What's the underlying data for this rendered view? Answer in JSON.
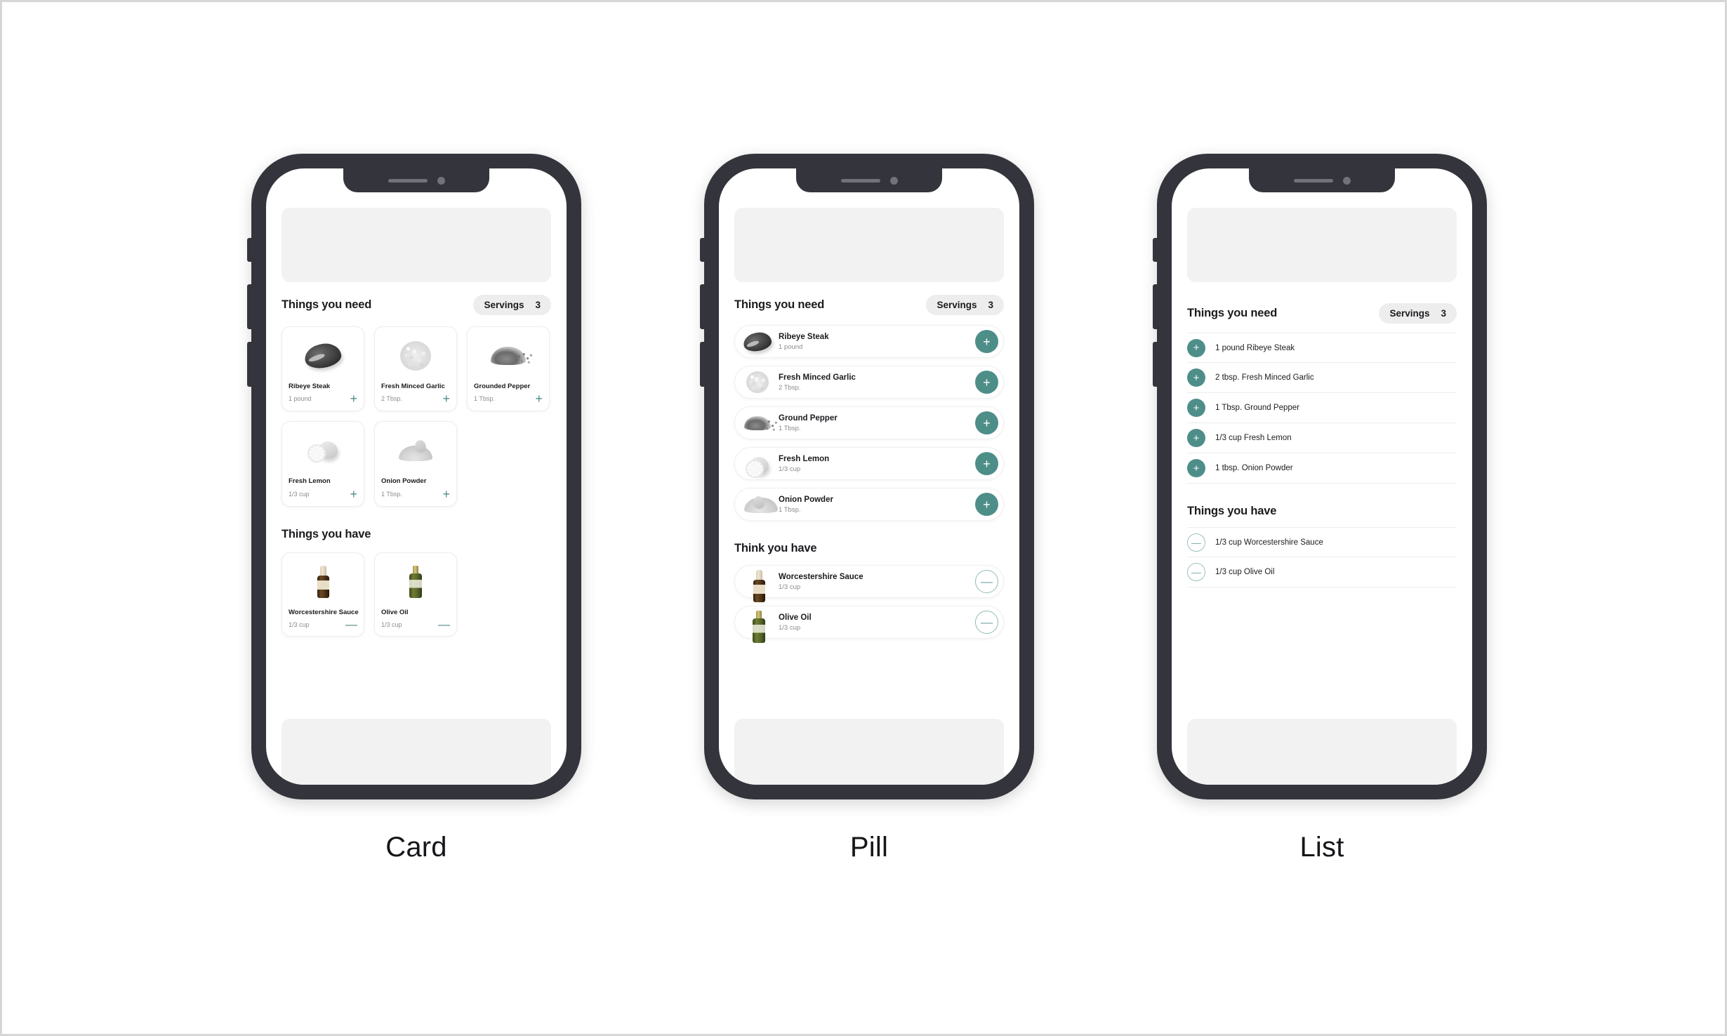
{
  "theme": {
    "accent_teal": "#4e8e89",
    "accent_teal_outline": "#8ebab6",
    "frame_dark": "#34343c",
    "placeholder_gray": "#f2f2f2",
    "pill_gray": "#ededed",
    "text_primary": "#1b1b1f",
    "text_muted": "#8b8b90"
  },
  "variants": [
    {
      "caption": "Card",
      "sections": [
        {
          "title": "Things you need",
          "servings": {
            "label": "Servings",
            "value": "3"
          },
          "items": [
            {
              "name": "Ribeye Steak",
              "qty": "1 pound",
              "action": "+",
              "icon": "steak-image"
            },
            {
              "name": "Fresh Minced Garlic",
              "qty": "2 Tbsp.",
              "action": "+",
              "icon": "garlic-image"
            },
            {
              "name": "Grounded Pepper",
              "qty": "1 Tbsp.",
              "action": "+",
              "icon": "ground-pepper-image"
            },
            {
              "name": "Fresh Lemon",
              "qty": "1/3 cup",
              "action": "+",
              "icon": "lemon-image"
            },
            {
              "name": "Onion Powder",
              "qty": "1 Tbsp.",
              "action": "+",
              "icon": "onion-powder-image"
            }
          ]
        },
        {
          "title": "Things you have",
          "items": [
            {
              "name": "Worcestershire Sauce",
              "qty": "1/3 cup",
              "action": "—",
              "icon": "worcestershire-sauce-image"
            },
            {
              "name": "Olive Oil",
              "qty": "1/3 cup",
              "action": "—",
              "icon": "olive-oil-image"
            }
          ]
        }
      ]
    },
    {
      "caption": "Pill",
      "sections": [
        {
          "title": "Things you need",
          "servings": {
            "label": "Servings",
            "value": "3"
          },
          "items": [
            {
              "name": "Ribeye Steak",
              "qty": "1 pound",
              "action": "+",
              "icon": "steak-image"
            },
            {
              "name": "Fresh Minced Garlic",
              "qty": "2 Tbsp.",
              "action": "+",
              "icon": "garlic-image"
            },
            {
              "name": "Ground Pepper",
              "qty": "1 Tbsp.",
              "action": "+",
              "icon": "ground-pepper-image"
            },
            {
              "name": "Fresh Lemon",
              "qty": "1/3 cup",
              "action": "+",
              "icon": "lemon-image"
            },
            {
              "name": "Onion Powder",
              "qty": "1 Tbsp.",
              "action": "+",
              "icon": "onion-powder-image"
            }
          ]
        },
        {
          "title": "Think you have",
          "items": [
            {
              "name": "Worcestershire Sauce",
              "qty": "1/3 cup",
              "action": "—",
              "icon": "worcestershire-sauce-image"
            },
            {
              "name": "Olive Oil",
              "qty": "1/3 cup",
              "action": "—",
              "icon": "olive-oil-image"
            }
          ]
        }
      ]
    },
    {
      "caption": "List",
      "sections": [
        {
          "title": "Things you need",
          "servings": {
            "label": "Servings",
            "value": "3"
          },
          "items": [
            {
              "label": "1 pound Ribeye Steak",
              "action": "+"
            },
            {
              "label": "2 tbsp. Fresh Minced Garlic",
              "action": "+"
            },
            {
              "label": "1 Tbsp. Ground Pepper",
              "action": "+"
            },
            {
              "label": "1/3 cup Fresh Lemon",
              "action": "+"
            },
            {
              "label": "1 tbsp. Onion Powder",
              "action": "+"
            }
          ]
        },
        {
          "title": "Things you have",
          "items": [
            {
              "label": "1/3 cup Worcestershire Sauce",
              "action": "—"
            },
            {
              "label": "1/3 cup Olive Oil",
              "action": "—"
            }
          ]
        }
      ]
    }
  ]
}
